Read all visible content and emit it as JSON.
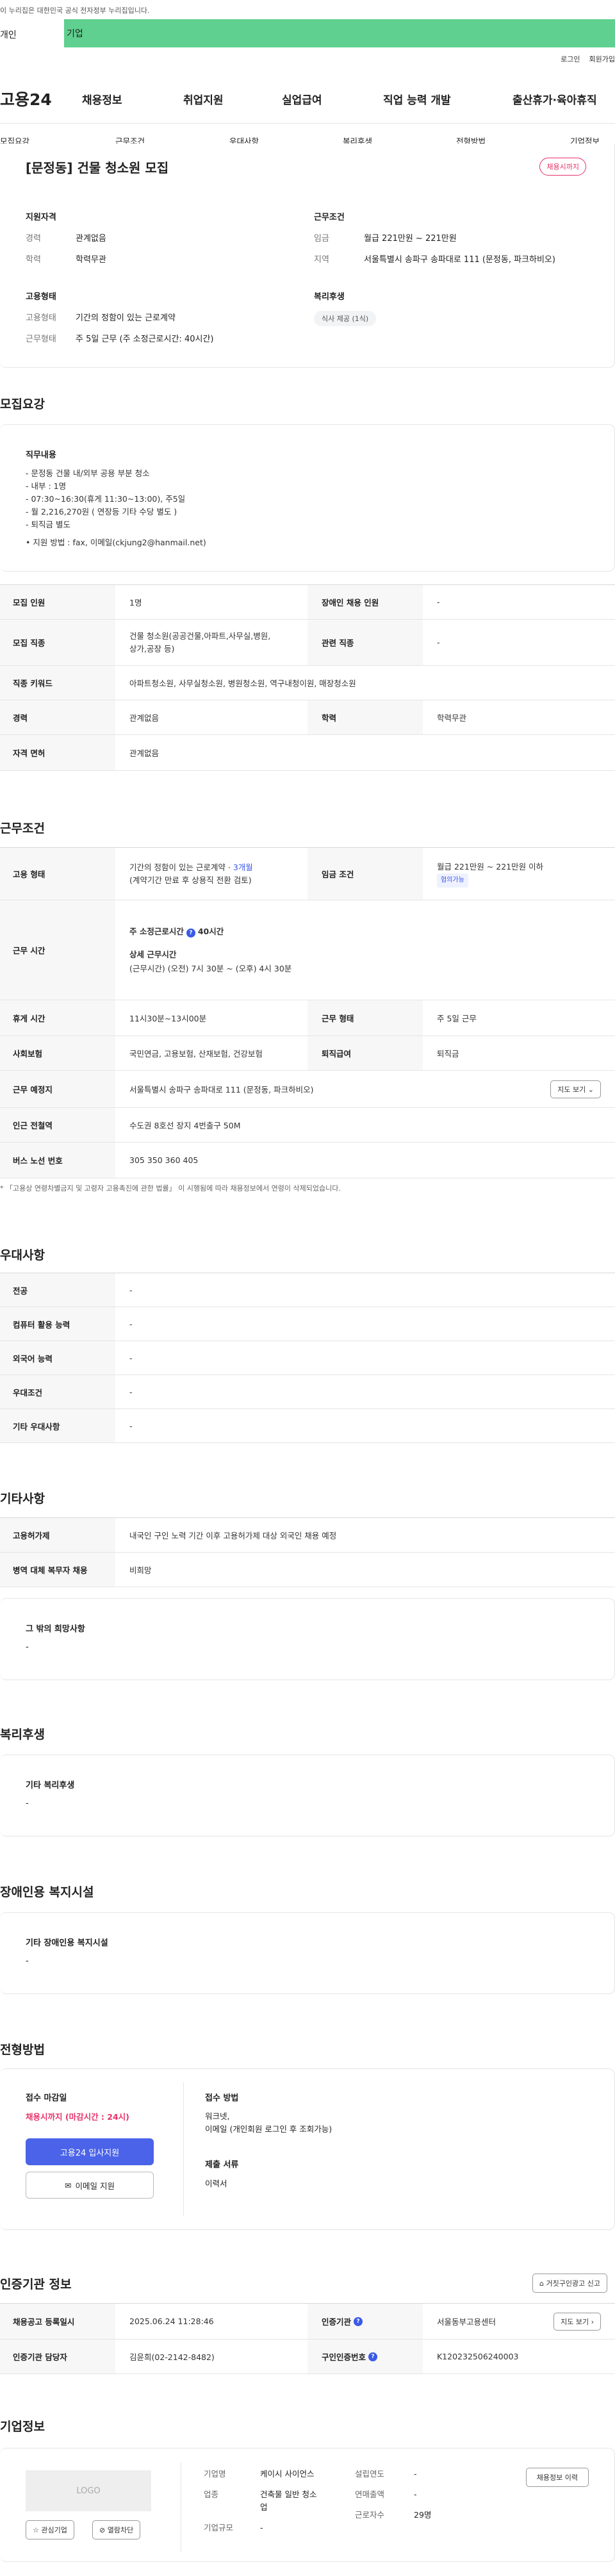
{
  "gov_banner": "이 누리집은 대한민국 공식 전자정부 누리집입니다.",
  "gnb": {
    "tab1": "개인",
    "tab2": "기업"
  },
  "util": {
    "login": "로그인",
    "join": "회원가입"
  },
  "logo": "고용24",
  "menu": [
    "채용정보",
    "취업지원",
    "실업급여",
    "직업 능력 개발",
    "출산휴가·육아휴직"
  ],
  "tabs": [
    "모집요강",
    "근무조건",
    "우대사항",
    "복리후생",
    "전형방법",
    "기업정보"
  ],
  "summary": {
    "title": "[문정동] 건물 청소원 모집",
    "badge": "채용시까지",
    "qual_title": "지원자격",
    "qual": [
      {
        "k": "경력",
        "v": "관계없음"
      },
      {
        "k": "학력",
        "v": "학력무관"
      }
    ],
    "emp_title": "고용형태",
    "emp": [
      {
        "k": "고용형태",
        "v": "기간의 정함이 있는 근로계약"
      },
      {
        "k": "근무형태",
        "v": "주 5일 근무 (주 소정근로시간: 40시간)"
      }
    ],
    "cond_title": "근무조건",
    "cond": [
      {
        "k": "임금",
        "v": "월급 221만원 ~ 221만원"
      },
      {
        "k": "지역",
        "v": "서울특별시 송파구 송파대로 111 (문정동, 파크하비오)"
      }
    ],
    "welfare_title": "복리후생",
    "welfare_pill": "식사 제공 (1식)"
  },
  "recruit": {
    "title": "모집요강",
    "duty_title": "직무내용",
    "duty_lines": [
      "- 문정동 건물 내/외부 공용 부분 청소",
      "- 내부 : 1명",
      "- 07:30~16:30(휴게 11:30~13:00), 주5일",
      "- 월 2,216,270원 ( 연장등 기타 수당 별도 )",
      "- 퇴직금 별도",
      "",
      "• 지원 방법 : fax, 이메일(ckjung2@hanmail.net)"
    ],
    "rows": [
      {
        "k": "모집 인원",
        "v": "1명",
        "k2": "장애인 채용 인원",
        "v2": "-"
      },
      {
        "k": "모집 직종",
        "v": "건물 청소원(공공건물,아파트,사무실,병원,",
        "v_b": "상가,공장 등)",
        "k2": "관련 직종",
        "v2": "-"
      },
      {
        "k": "직종 키워드",
        "v": "아파트청소원, 사무실청소원, 병원청소원, 역구내청이원, 매장청소원"
      },
      {
        "k": "경력",
        "v": "관계없음",
        "k2": "학력",
        "v2": "학력무관"
      },
      {
        "k": "자격 면허",
        "v": "관계없음"
      }
    ]
  },
  "work": {
    "title": "근무조건",
    "emp_k": "고용 형태",
    "emp_v1": "기간의 정함이 있는 근로계약 ·",
    "emp_months": "3개월",
    "emp_v2": "(계약기간 만료 후 상용직 전환 검토)",
    "wage_k": "임금 조건",
    "wage_v": "월급 221만원 ~ 221만원 이하",
    "wage_tag": "협의가능",
    "hours_k": "근무 시간",
    "hours_main": "주 소정근로시간",
    "hours_main_v": "40시간",
    "hours_detail_title": "상세 근무시간",
    "hours_detail": "(근무시간) (오전) 7시 30분 ~ (오후) 4시 30분",
    "rows": [
      {
        "k": "휴게 시간",
        "v": "11시30분~13시00분",
        "k2": "근무 형태",
        "v2": "주 5일 근무"
      },
      {
        "k": "사회보험",
        "v": "국민연금, 고용보험, 산재보험, 건강보험",
        "k2": "퇴직급여",
        "v2": "퇴직금"
      }
    ],
    "place_k": "근무 예정지",
    "place_v": "서울특별시 송파구 송파대로 111 (문정동, 파크하비오)",
    "map_btn": "지도 보기",
    "subway_k": "인근 전철역",
    "subway_v": "수도권 8호선 장지 4번출구 50M",
    "bus_k": "버스 노선 번호",
    "bus_v": "305 350 360 405",
    "note": "* 「고용상 연령차별금지 및 고령자 고용촉진에 관한 법률」 이 시행됨에 따라 채용정보에서 연령이 삭제되었습니다."
  },
  "pref": {
    "title": "우대사항",
    "rows": [
      {
        "k": "전공",
        "v": "-"
      },
      {
        "k": "컴퓨터 활용 능력",
        "v": "-"
      },
      {
        "k": "외국어 능력",
        "v": "-"
      },
      {
        "k": "우대조건",
        "v": "-"
      },
      {
        "k": "기타 우대사항",
        "v": "-"
      }
    ]
  },
  "other": {
    "title": "기타사항",
    "rows": [
      {
        "k": "고용허가제",
        "v": "내국인 구인 노력 기간 이후 고용허가제 대상 외국인 채용 예정"
      },
      {
        "k": "병역 대체 복무자 채용",
        "v": "비희망"
      }
    ],
    "wish_title": "그 밖의 희망사항",
    "wish_v": "-"
  },
  "welfare": {
    "title": "복리후생",
    "sub": "기타 복리후생",
    "v": "-"
  },
  "disabled": {
    "title": "장애인용 복지시설",
    "sub": "기타 장애인용 복지시설",
    "v": "-"
  },
  "apply": {
    "title": "전형방법",
    "deadline_title": "접수 마감일",
    "deadline_v": "채용시까지 (마감시간 : 24시)",
    "apply_btn": "고용24 입사지원",
    "email_btn": "이메일 지원",
    "method_title": "접수 방법",
    "method_v1": "워크넷,",
    "method_v2": "이메일 (개인회원 로그인 후 조회가능)",
    "docs_title": "제출 서류",
    "docs_v": "이력서"
  },
  "agency": {
    "title": "인증기관 정보",
    "report_btn": "거짓구인광고 신고",
    "rows": [
      {
        "k": "채용공고 등록일시",
        "v": "2025.06.24 11:28:46",
        "k2": "인증기관",
        "v2": "서울동부고용센터",
        "btn": "지도 보기"
      },
      {
        "k": "인증기관 담당자",
        "v": "김윤희(02-2142-8482)",
        "k2": "구인인증번호",
        "v2": "K120232506240003"
      }
    ]
  },
  "company": {
    "title": "기업정보",
    "logo": "LOGO",
    "fav_btn": "관심기업",
    "block_btn": "열람차단",
    "history_btn": "채용정보 이력",
    "fields": [
      {
        "k": "기업명",
        "v": "케이시 사이언스"
      },
      {
        "k": "업종",
        "v": "건축물 일반 청소",
        "v_b": "업"
      },
      {
        "k": "기업규모",
        "v": "-"
      },
      {
        "k": "설립연도",
        "v": "-"
      },
      {
        "k": "연매출액",
        "v": "-"
      },
      {
        "k": "근로자수",
        "v": "29명"
      }
    ]
  },
  "colors": {
    "accent": "#3a5ae8",
    "gnb": "#5fd08f",
    "alert": "#e8336a"
  }
}
